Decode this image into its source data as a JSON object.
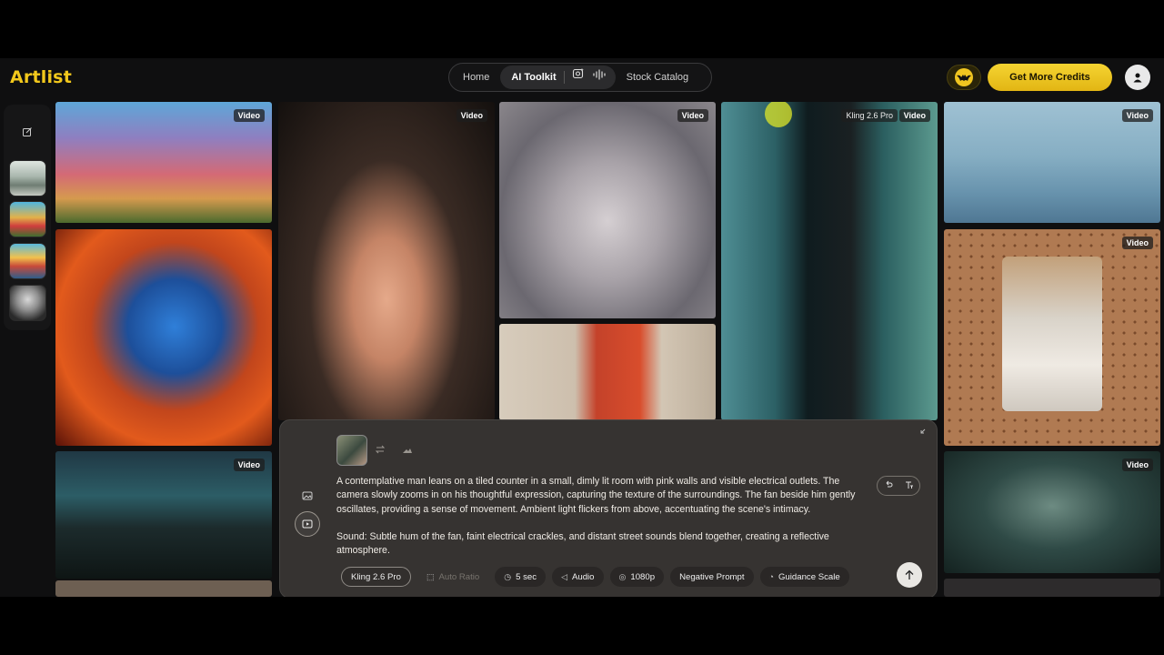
{
  "header": {
    "logo": "Artlist",
    "nav": [
      {
        "label": "Home"
      },
      {
        "label": "AI Toolkit"
      },
      {
        "label": "Stock Catalog"
      }
    ],
    "credits_button": "Get More Credits"
  },
  "colors": {
    "accent": "#f2c81c",
    "background": "#0f0f10",
    "panel": "#3a3634"
  },
  "icons": {
    "nav_image": "image-sparkle-icon",
    "nav_audio": "audio-wave-icon",
    "avatar": "user-icon",
    "new": "edit-icon"
  },
  "gallery": {
    "badge": "Video",
    "model_badge": "Kling 2.6 Pro"
  },
  "prompt_panel": {
    "text_1": "A contemplative man leans on a tiled counter in a small, dimly lit room with pink walls and visible electrical outlets. The camera slowly zooms in on his thoughtful expression, capturing the texture of the surroundings. The fan beside him gently oscillates, providing a sense of movement. Ambient light flickers from above, accentuating the scene's intimacy.",
    "text_2": "Sound: Subtle hum of the fan, faint electrical crackles, and distant street sounds blend together, creating a reflective atmosphere.",
    "chips": {
      "model": "Kling 2.6 Pro",
      "ratio": "Auto Ratio",
      "duration": "5 sec",
      "audio": "Audio",
      "resolution": "1080p",
      "negative": "Negative Prompt",
      "guidance": "Guidance Scale"
    }
  }
}
